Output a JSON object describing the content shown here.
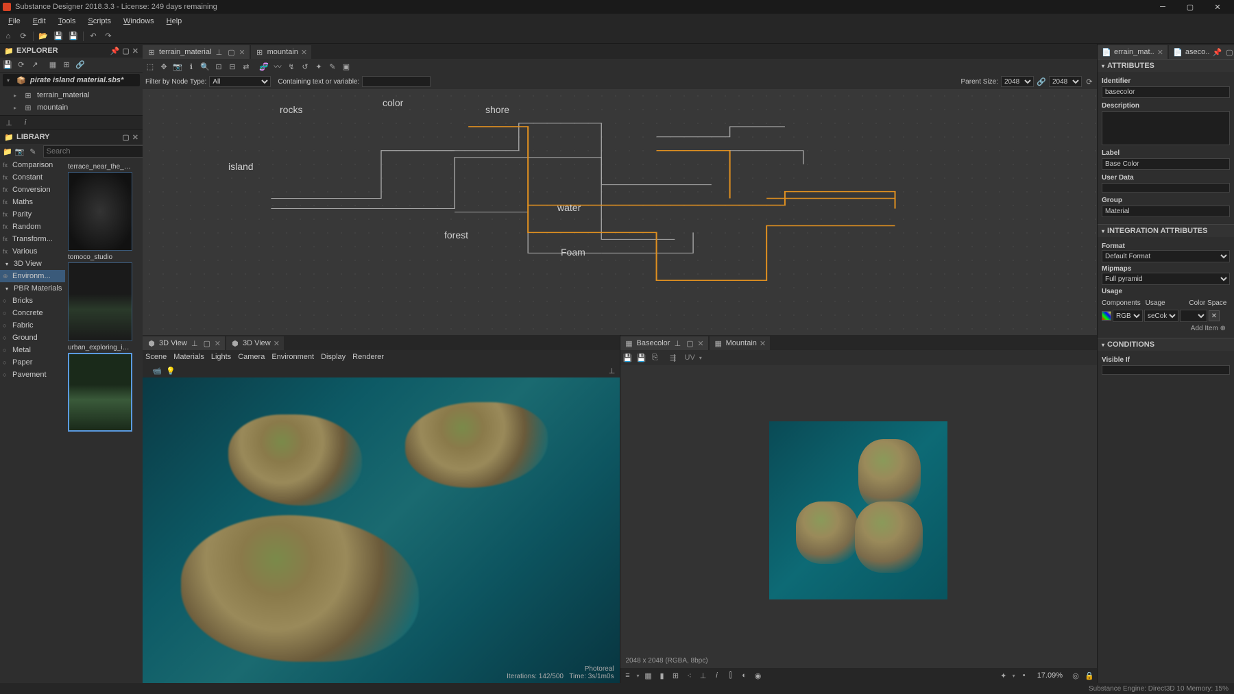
{
  "app": {
    "title": "Substance Designer 2018.3.3 - License: 249 days remaining"
  },
  "menu": [
    "File",
    "Edit",
    "Tools",
    "Scripts",
    "Windows",
    "Help"
  ],
  "explorer": {
    "title": "EXPLORER",
    "file": "pirate island material.sbs*",
    "items": [
      {
        "label": "terrain_material"
      },
      {
        "label": "mountain"
      }
    ]
  },
  "library": {
    "title": "LIBRARY",
    "search_placeholder": "Search",
    "categories_fx": [
      "Comparison",
      "Constant",
      "Conversion",
      "Maths",
      "Parity",
      "Random",
      "Transform...",
      "Various"
    ],
    "cat_3dview": "3D View",
    "cat_env": "Environm...",
    "cat_pbr": "PBR Materials",
    "categories_pbr": [
      "Bricks",
      "Concrete",
      "Fabric",
      "Ground",
      "Metal",
      "Paper",
      "Pavement"
    ],
    "thumbs": [
      {
        "label": "terrace_near_the_gra..."
      },
      {
        "label": "tomoco_studio"
      },
      {
        "label": "urban_exploring_inte..."
      }
    ]
  },
  "graph": {
    "tabs": [
      {
        "label": "terrain_material",
        "active": true
      },
      {
        "label": "mountain",
        "active": false
      }
    ],
    "filter_label": "Filter by Node Type:",
    "filter_all": "All",
    "containing_label": "Containing text or variable:",
    "parent_size_label": "Parent Size:",
    "parent_size_1": "2048",
    "parent_size_2": "2048",
    "labels": {
      "island": "island",
      "rocks": "rocks",
      "color": "color",
      "shore": "shore",
      "forest": "forest",
      "water": "water",
      "foam": "Foam"
    }
  },
  "view3d": {
    "tab1": "3D View",
    "tab2": "3D View",
    "menu": [
      "Scene",
      "Materials",
      "Lights",
      "Camera",
      "Environment",
      "Display",
      "Renderer"
    ],
    "env_mode": "Photoreal",
    "iterations": "Iterations: 142/500",
    "time": "Time: 3s/1m0s"
  },
  "view2d": {
    "tabs": [
      {
        "label": "Basecolor",
        "active": true
      },
      {
        "label": "Mountain",
        "active": false
      }
    ],
    "uv_label": "UV",
    "info": "2048 x 2048 (RGBA, 8bpc)",
    "zoom": "17.09%"
  },
  "attributes": {
    "tabs": [
      {
        "label": "errain_mat..",
        "active": true
      },
      {
        "label": "aseco..",
        "active": false
      }
    ],
    "section_attributes": "ATTRIBUTES",
    "identifier_label": "Identifier",
    "identifier_value": "basecolor",
    "description_label": "Description",
    "label_label": "Label",
    "label_value": "Base Color",
    "userdata_label": "User Data",
    "group_label": "Group",
    "group_value": "Material",
    "section_integration": "INTEGRATION ATTRIBUTES",
    "format_label": "Format",
    "format_value": "Default Format",
    "mipmaps_label": "Mipmaps",
    "mipmaps_value": "Full pyramid",
    "usage_label": "Usage",
    "usage_components": "Components",
    "usage_usage": "Usage",
    "usage_colorspace": "Color Space",
    "usage_rgba": "RGBA",
    "usage_ecolor": "seColor",
    "add_item": "Add Item",
    "section_conditions": "CONDITIONS",
    "visibleif_label": "Visible If"
  },
  "status": "Substance Engine: Direct3D 10  Memory: 15%"
}
